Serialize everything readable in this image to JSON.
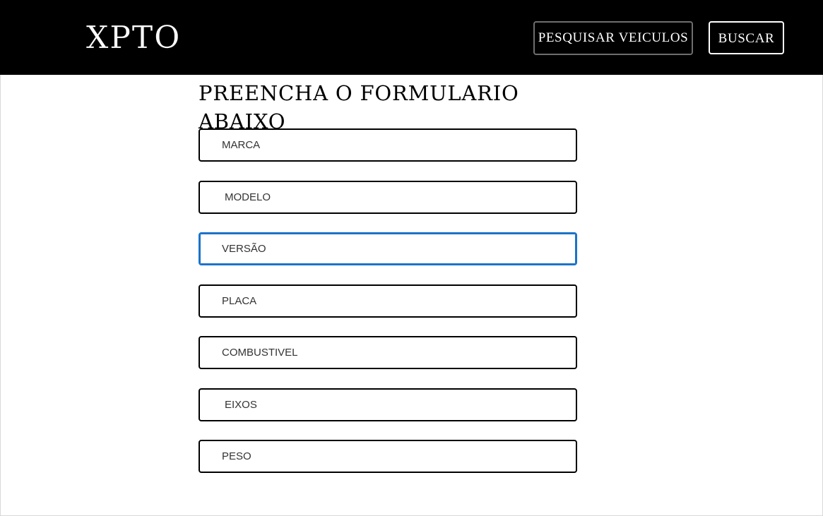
{
  "header": {
    "logo": "XPTO",
    "nav": {
      "pesquisar_label": "PESQUISAR VEICULOS",
      "buscar_label": "BUSCAR"
    }
  },
  "form": {
    "title": "PREENCHA O FORMULARIO ABAIXO",
    "fields": {
      "marca": {
        "placeholder": "MARCA",
        "value": ""
      },
      "modelo": {
        "placeholder": "MODELO",
        "value": ""
      },
      "versao": {
        "placeholder": "VERSÃO",
        "value": ""
      },
      "placa": {
        "placeholder": "PLACA",
        "value": ""
      },
      "combustivel": {
        "placeholder": "COMBUSTIVEL",
        "value": ""
      },
      "eixos": {
        "placeholder": "EIXOS",
        "value": ""
      },
      "peso": {
        "placeholder": "PESO",
        "value": ""
      }
    },
    "focused_field": "versao"
  },
  "colors": {
    "header_bg": "#000000",
    "focus_border": "#1a73c9",
    "field_border": "#000000"
  }
}
